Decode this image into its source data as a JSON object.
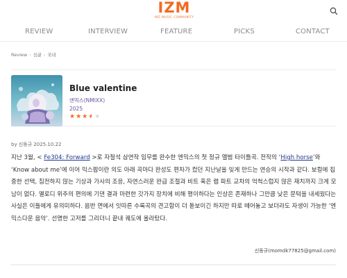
{
  "header": {
    "logo_text": "IZM",
    "logo_sub": "IMZ MUSIC COMMUNITY"
  },
  "nav": {
    "items": [
      "REVIEW",
      "INTERVIEW",
      "FEATURE",
      "PICKS",
      "CONTACT"
    ]
  },
  "breadcrumb": {
    "items": [
      "Review",
      "싱글",
      "국내"
    ]
  },
  "album": {
    "title": "Blue valentine",
    "artist": "엔믹스(NMIXX)",
    "year": "2025",
    "rating": 3.5,
    "rating_max": 5
  },
  "byline": {
    "text": "by 신동규   2025.10.22"
  },
  "review": {
    "p1_pre": "지난 3월, < ",
    "link1": "Fe304: Forward",
    "p1_mid": " >로 자철석 삼연작 임무를 완수한 엔믹스의 첫 정규 앨범 타이틀곡. 전작의 ‘",
    "link2": "High horse",
    "p1_post": "’와 ‘Know about me’에 이어 믹스팝이란 의도 아래 곡마다 완성도 편차가 컸던 지난날을 잊게 만드는 연승의 시작과 같다. 보컬에 집중한 선택, 침전하지 않는 기상과 가사의 조응, 자연스러운 완급 조절과 비트 혹은 랩 파트 교차의 억척스럽지 않은 재치까지 크게 모남이 없다. 멜로디 위주의 편의에 기댄 결과 마련한 갓가지 장치에 비해 평이하다는 인상은 존재하나 그만큼 낮은 문턱을 내세웠다는 사실은 이들에게 유의미하다. 음반 면에서 잇따른 수록곡의 견고함이 더 돋보이긴 하지만 따로 떼어놓고 보더라도 자생이 가능한 ‘엔믹스다운 음악’. 선명한 고저를 그리더니 끝내 궤도에 올라탔다."
  },
  "author": {
    "email": "신동규(momdk77825@gmail.com)"
  },
  "colors": {
    "brand": "#f26a21",
    "link": "#1e3a8a",
    "meta": "#6a4f9e"
  },
  "icons": {
    "search": "search-icon"
  }
}
